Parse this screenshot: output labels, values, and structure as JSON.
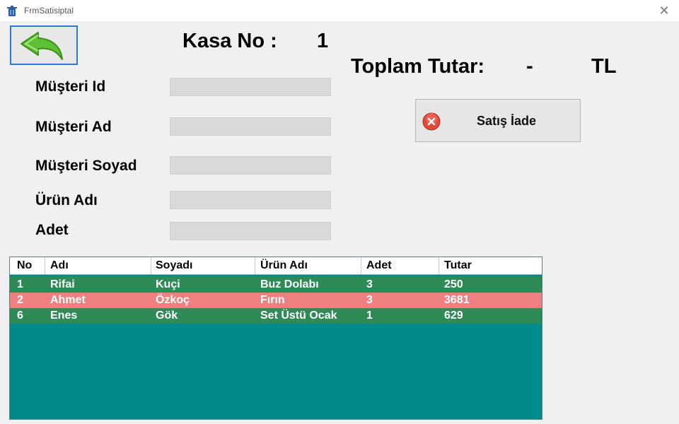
{
  "window": {
    "title": "FrmSatisiptal",
    "app_icon": "trash-icon",
    "close_label": "✕"
  },
  "header": {
    "back_button_icon": "green-back-arrow-icon",
    "kasa_label": "Kasa No :",
    "kasa_value": "1",
    "toplam_label": "Toplam Tutar:",
    "toplam_value": "-",
    "toplam_unit": "TL"
  },
  "form": {
    "fields": [
      {
        "label": "Müşteri Id",
        "value": ""
      },
      {
        "label": "Müşteri Ad",
        "value": ""
      },
      {
        "label": "Müşteri Soyad",
        "value": ""
      },
      {
        "label": "Ürün Adı",
        "value": ""
      },
      {
        "label": "Adet",
        "value": ""
      }
    ]
  },
  "actions": {
    "iade_label": "Satış İade",
    "iade_icon": "red-cancel-icon"
  },
  "grid": {
    "columns": [
      "No",
      "Adı",
      "Soyadı",
      "Ürün Adı",
      "Adet",
      "Tutar"
    ],
    "rows": [
      {
        "cells": [
          "1",
          "Rifai",
          "Kuçi",
          "Buz Dolabı",
          "3",
          "250"
        ],
        "bg": "#2e8b57",
        "fg": "#ffffff"
      },
      {
        "cells": [
          "2",
          "Ahmet",
          "Özkoç",
          "Fırın",
          "3",
          "3681"
        ],
        "bg": "#f08080",
        "fg": "#ffffff"
      },
      {
        "cells": [
          "6",
          "Enes",
          "Gök",
          "Set Üstü Ocak",
          "1",
          "629"
        ],
        "bg": "#2e8b57",
        "fg": "#ffffff"
      }
    ],
    "background_color": "#008b8b"
  }
}
